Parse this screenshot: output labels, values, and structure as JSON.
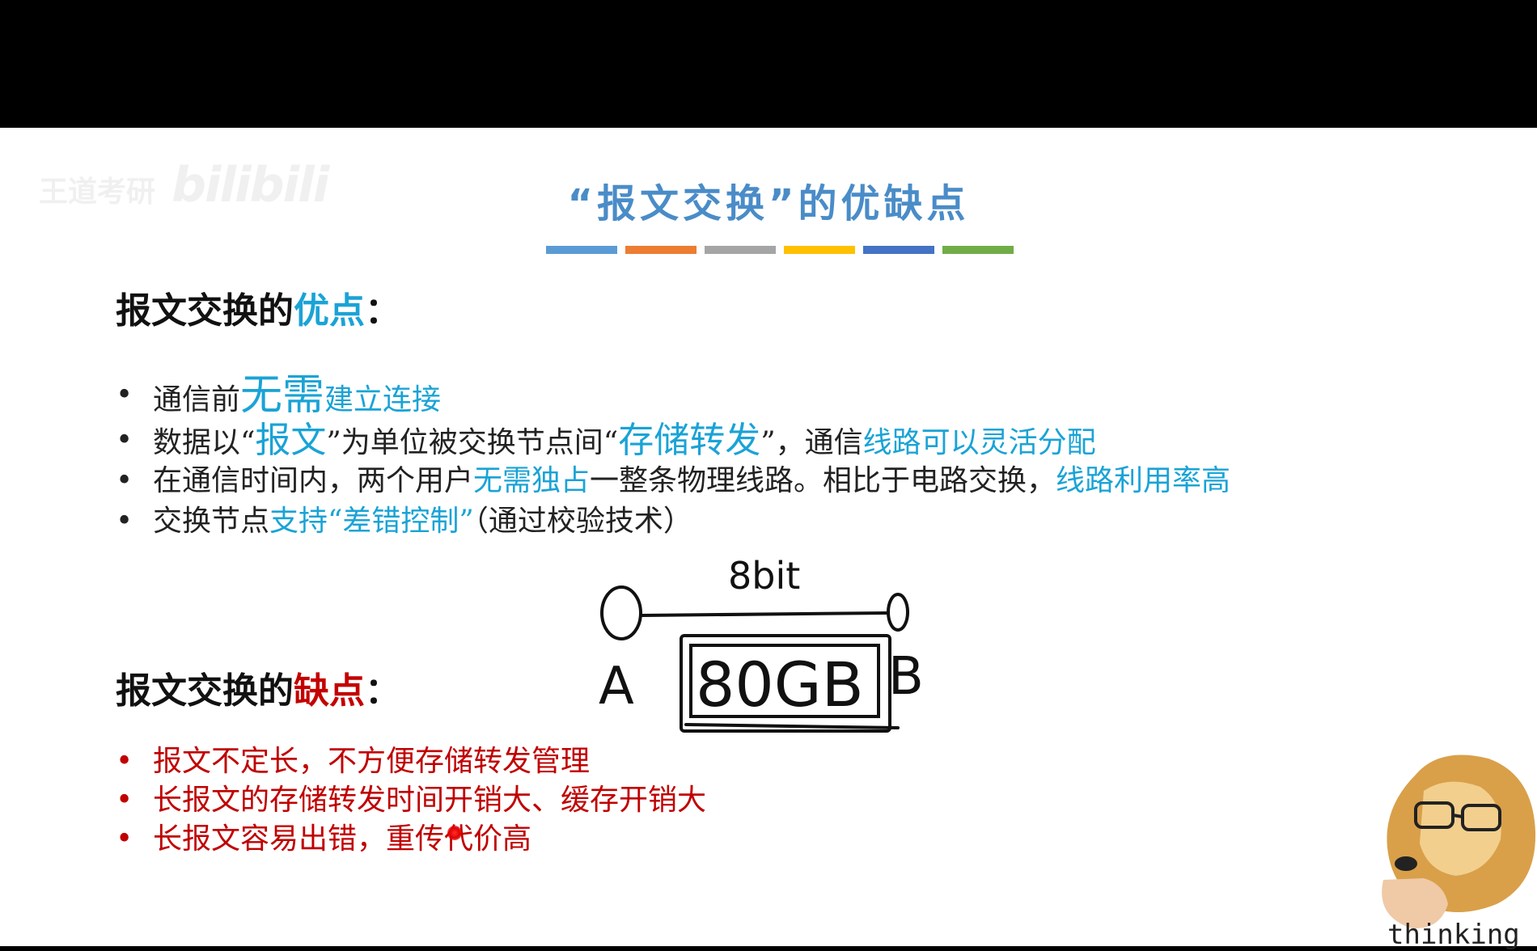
{
  "watermark": {
    "channel": "王道考研",
    "brand": "bilibili"
  },
  "slide": {
    "title": "“报文交换”的优缺点",
    "title_rule_colors": [
      "#5b9bd5",
      "#ed7d31",
      "#a5a5a5",
      "#ffc000",
      "#4472c4",
      "#70ad47"
    ],
    "pros_heading": {
      "prefix": "报文交换的",
      "highlight": "优点",
      "suffix": "："
    },
    "pros": [
      {
        "parts": [
          {
            "t": "通信前",
            "c": ""
          },
          {
            "t": "无需",
            "c": "c-blue big"
          },
          {
            "t": "建立连接",
            "c": "c-blue"
          }
        ]
      },
      {
        "parts": [
          {
            "t": "数据以“",
            "c": ""
          },
          {
            "t": "报文",
            "c": "c-blue mid"
          },
          {
            "t": "”为单位被交换节点间“",
            "c": ""
          },
          {
            "t": "存储转发",
            "c": "c-blue mid"
          },
          {
            "t": "”，通信",
            "c": ""
          },
          {
            "t": "线路可以灵活分配",
            "c": "c-blue"
          }
        ]
      },
      {
        "parts": [
          {
            "t": "在通信时间内，两个用户",
            "c": ""
          },
          {
            "t": "无需独占",
            "c": "c-blue"
          },
          {
            "t": "一整条物理线路。相比于电路交换，",
            "c": ""
          },
          {
            "t": "线路利用率高",
            "c": "c-blue"
          }
        ]
      },
      {
        "parts": [
          {
            "t": "交换节点",
            "c": ""
          },
          {
            "t": "支持“差错控制”",
            "c": "c-blue"
          },
          {
            "t": "（通过校验技术）",
            "c": ""
          }
        ]
      }
    ],
    "cons_heading": {
      "prefix": "报文交换的",
      "highlight": "缺点",
      "suffix": "："
    },
    "cons": [
      "报文不定长，不方便存储转发管理",
      "长报文的存储转发时间开销大、缓存开销大",
      "长报文容易出错，重传代价高"
    ]
  },
  "sketch": {
    "link_label": "8bit",
    "message_label": "80GB",
    "node_a": "A",
    "node_b": "B"
  },
  "sticker": {
    "label": "thinking"
  }
}
